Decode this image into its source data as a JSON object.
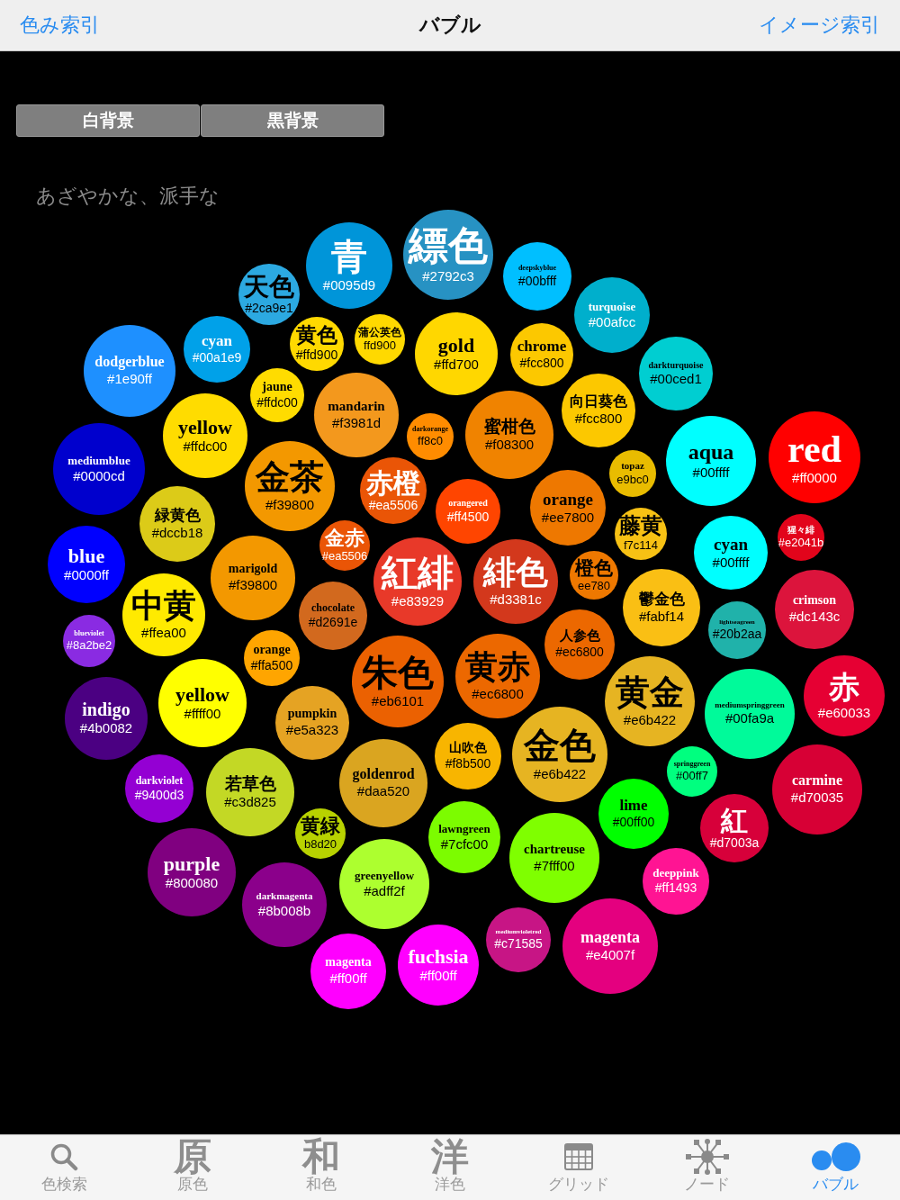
{
  "nav": {
    "left_link": "色み索引",
    "title": "バブル",
    "right_link": "イメージ索引"
  },
  "background_toggle": [
    {
      "label": "白背景"
    },
    {
      "label": "黒背景"
    }
  ],
  "heading": "あざやかな、派手な",
  "bubbles": [
    {
      "name": "天色",
      "code": "#2ca9e1",
      "color": "#2ca9e1"
    },
    {
      "name": "青",
      "code": "#0095d9",
      "color": "#0095d9"
    },
    {
      "name": "縹色",
      "code": "#2792c3",
      "color": "#2792c3"
    },
    {
      "name": "deepskyblue",
      "code": "#00bfff",
      "color": "#00bfff"
    },
    {
      "name": "turquoise",
      "code": "#00afcc",
      "color": "#00afcc"
    },
    {
      "name": "dodgerblue",
      "code": "#1e90ff",
      "color": "#1e90ff"
    },
    {
      "name": "cyan",
      "code": "#00a1e9",
      "color": "#00a1e9"
    },
    {
      "name": "jaune",
      "code": "#ffdc00",
      "color": "#ffdc00"
    },
    {
      "name": "黄色",
      "code": "#ffd900",
      "color": "#ffd900"
    },
    {
      "name": "蒲公英色",
      "code": "ffd900",
      "color": "#ffd900"
    },
    {
      "name": "gold",
      "code": "#ffd700",
      "color": "#ffd700"
    },
    {
      "name": "chrome",
      "code": "#fcc800",
      "color": "#fcc800"
    },
    {
      "name": "darkturquoise",
      "code": "#00ced1",
      "color": "#00ced1"
    },
    {
      "name": "yellow",
      "code": "#ffdc00",
      "color": "#ffdc00"
    },
    {
      "name": "mandarin",
      "code": "#f3981d",
      "color": "#f3981d"
    },
    {
      "name": "darkorange",
      "code": "ff8c0",
      "color": "#ff8c00"
    },
    {
      "name": "蜜柑色",
      "code": "#f08300",
      "color": "#f08300"
    },
    {
      "name": "向日葵色",
      "code": "#fcc800",
      "color": "#fcc800"
    },
    {
      "name": "mediumblue",
      "code": "#0000cd",
      "color": "#0000cd"
    },
    {
      "name": "金茶",
      "code": "#f39800",
      "color": "#f39800"
    },
    {
      "name": "赤橙",
      "code": "#ea5506",
      "color": "#ea5506"
    },
    {
      "name": "orangered",
      "code": "#ff4500",
      "color": "#ff4500"
    },
    {
      "name": "orange",
      "code": "#ee7800",
      "color": "#ee7800"
    },
    {
      "name": "topaz",
      "code": "e9bc0",
      "color": "#e9bc00"
    },
    {
      "name": "aqua",
      "code": "#00ffff",
      "color": "#00ffff"
    },
    {
      "name": "red",
      "code": "#ff0000",
      "color": "#ff0000"
    },
    {
      "name": "blue",
      "code": "#0000ff",
      "color": "#0000ff"
    },
    {
      "name": "緑黄色",
      "code": "#dccb18",
      "color": "#dccb18"
    },
    {
      "name": "marigold",
      "code": "#f39800",
      "color": "#f39800"
    },
    {
      "name": "金赤",
      "code": "#ea5506",
      "color": "#ea5506"
    },
    {
      "name": "橙色",
      "code": "ee780",
      "color": "#ee7800"
    },
    {
      "name": "藤黄",
      "code": "f7c114",
      "color": "#f7c114"
    },
    {
      "name": "cyan",
      "code": "#00ffff",
      "color": "#00ffff"
    },
    {
      "name": "猩々緋",
      "code": "#e2041b",
      "color": "#e2041b"
    },
    {
      "name": "中黄",
      "code": "#ffea00",
      "color": "#ffea00"
    },
    {
      "name": "chocolate",
      "code": "#d2691e",
      "color": "#d2691e"
    },
    {
      "name": "紅緋",
      "code": "#e83929",
      "color": "#e83929"
    },
    {
      "name": "緋色",
      "code": "#d3381c",
      "color": "#d3381c"
    },
    {
      "name": "鬱金色",
      "code": "#fabf14",
      "color": "#fabf14"
    },
    {
      "name": "lightseagreen",
      "code": "#20b2aa",
      "color": "#20b2aa"
    },
    {
      "name": "crimson",
      "code": "#dc143c",
      "color": "#dc143c"
    },
    {
      "name": "blueviolet",
      "code": "#8a2be2",
      "color": "#8a2be2"
    },
    {
      "name": "orange",
      "code": "#ffa500",
      "color": "#ffa500"
    },
    {
      "name": "人参色",
      "code": "#ec6800",
      "color": "#ec6800"
    },
    {
      "name": "indigo",
      "code": "#4b0082",
      "color": "#4b0082"
    },
    {
      "name": "yellow",
      "code": "#ffff00",
      "color": "#ffff00"
    },
    {
      "name": "pumpkin",
      "code": "#e5a323",
      "color": "#e5a323"
    },
    {
      "name": "朱色",
      "code": "#eb6101",
      "color": "#eb6101"
    },
    {
      "name": "黄赤",
      "code": "#ec6800",
      "color": "#ec6800"
    },
    {
      "name": "黄金",
      "code": "#e6b422",
      "color": "#e6b422"
    },
    {
      "name": "mediumspringgreen",
      "code": "#00fa9a",
      "color": "#00fa9a"
    },
    {
      "name": "赤",
      "code": "#e60033",
      "color": "#e60033"
    },
    {
      "name": "darkviolet",
      "code": "#9400d3",
      "color": "#9400d3"
    },
    {
      "name": "若草色",
      "code": "#c3d825",
      "color": "#c3d825"
    },
    {
      "name": "goldenrod",
      "code": "#daa520",
      "color": "#daa520"
    },
    {
      "name": "山吹色",
      "code": "#f8b500",
      "color": "#f8b500"
    },
    {
      "name": "金色",
      "code": "#e6b422",
      "color": "#e6b422"
    },
    {
      "name": "springgreen",
      "code": "#00ff7",
      "color": "#00ff7f"
    },
    {
      "name": "carmine",
      "code": "#d70035",
      "color": "#d70035"
    },
    {
      "name": "黄緑",
      "code": "b8d20",
      "color": "#b8d200"
    },
    {
      "name": "lawngreen",
      "code": "#7cfc00",
      "color": "#7cfc00"
    },
    {
      "name": "lime",
      "code": "#00ff00",
      "color": "#00ff00"
    },
    {
      "name": "紅",
      "code": "#d7003a",
      "color": "#d7003a"
    },
    {
      "name": "purple",
      "code": "#800080",
      "color": "#800080"
    },
    {
      "name": "darkmagenta",
      "code": "#8b008b",
      "color": "#8b008b"
    },
    {
      "name": "greenyellow",
      "code": "#adff2f",
      "color": "#adff2f"
    },
    {
      "name": "chartreuse",
      "code": "#7fff00",
      "color": "#7fff00"
    },
    {
      "name": "deeppink",
      "code": "#ff1493",
      "color": "#ff1493"
    },
    {
      "name": "magenta",
      "code": "#ff00ff",
      "color": "#ff00ff"
    },
    {
      "name": "fuchsia",
      "code": "#ff00ff",
      "color": "#ff00ff"
    },
    {
      "name": "mediumvioletred",
      "code": "#c71585",
      "color": "#c71585"
    },
    {
      "name": "magenta",
      "code": "#e4007f",
      "color": "#e4007f"
    }
  ],
  "tab_bar": [
    {
      "kind": "search",
      "label": "色検索",
      "selected": false
    },
    {
      "kind": "glyph",
      "glyph": "原",
      "label": "原色",
      "selected": false
    },
    {
      "kind": "glyph",
      "glyph": "和",
      "label": "和色",
      "selected": false
    },
    {
      "kind": "glyph",
      "glyph": "洋",
      "label": "洋色",
      "selected": false
    },
    {
      "kind": "grid",
      "label": "グリッド",
      "selected": false
    },
    {
      "kind": "network",
      "label": "ノード",
      "selected": false
    },
    {
      "kind": "bubbles",
      "label": "バブル",
      "selected": true
    }
  ]
}
